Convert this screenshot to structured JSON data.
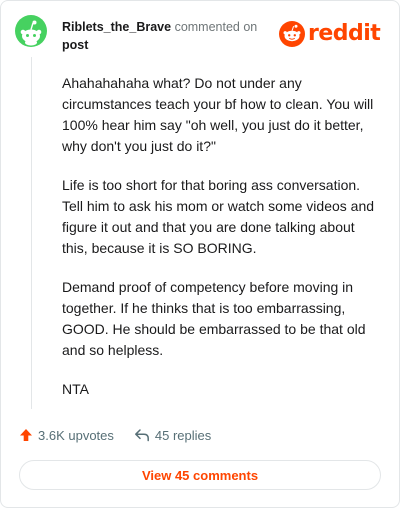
{
  "header": {
    "username": "Riblets_the_Brave",
    "action_text": "commented on",
    "post_text": "post",
    "brand": "reddit"
  },
  "comment": {
    "paragraphs": [
      "Ahahahahaha what? Do not under any circumstances teach your bf how to clean. You will 100% hear him say \"oh well, you just do it better, why don't you just do it?\"",
      "Life is too short for that boring ass conversation. Tell him to ask his mom or watch some videos and figure it out and that you are done talking about this, because it is SO BORING.",
      "Demand proof of competency before moving in together. If he thinks that is too embarrassing, GOOD. He should be embarrassed to be that old and so helpless.",
      "NTA"
    ]
  },
  "actions": {
    "upvotes_label": "3.6K upvotes",
    "replies_label": "45 replies"
  },
  "footer": {
    "view_comments_label": "View 45 comments"
  },
  "colors": {
    "brand": "#ff4500",
    "avatar_bg": "#46d160",
    "muted": "#576f76",
    "border": "#e3e6e8"
  },
  "icons": {
    "avatar": "snoo-avatar-icon",
    "logo": "reddit-snoo-icon",
    "upvote": "upvote-arrow-icon",
    "reply": "reply-arrow-icon"
  }
}
